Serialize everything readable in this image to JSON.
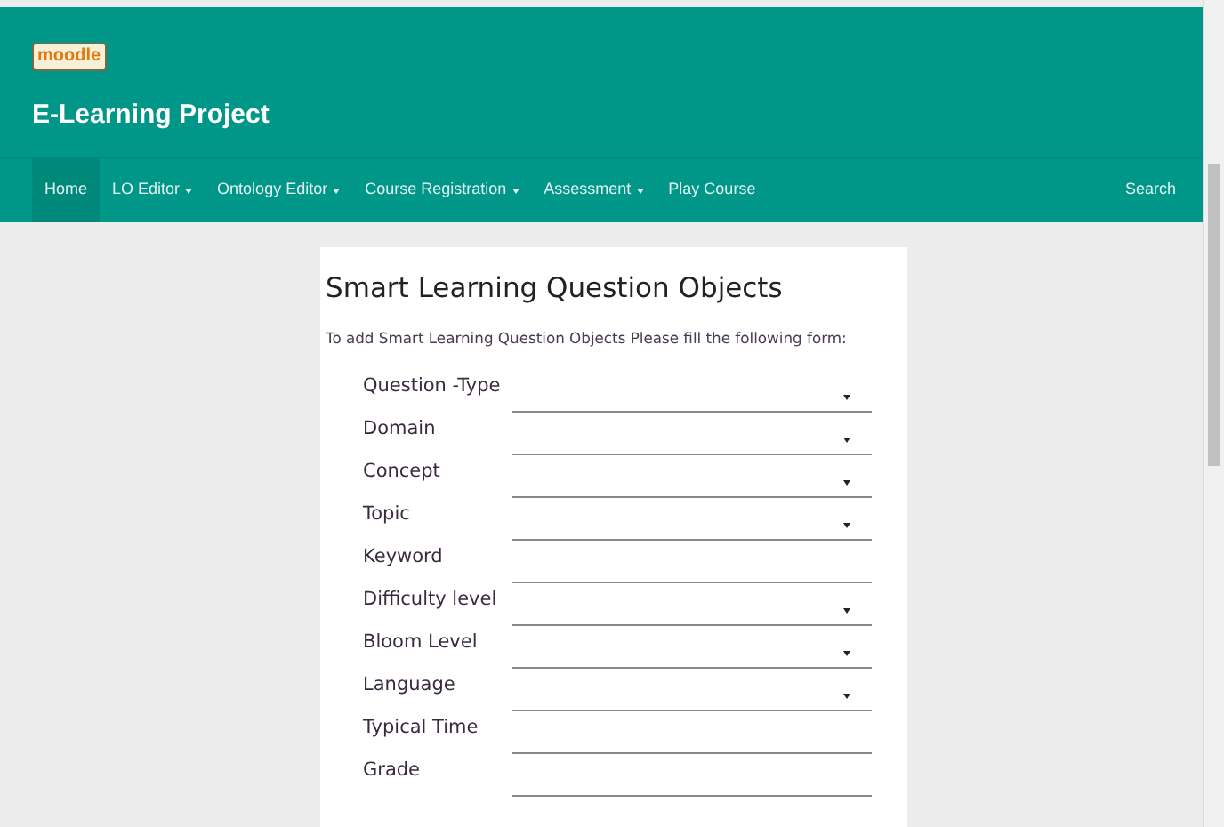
{
  "header": {
    "logo": "moodle",
    "title": "E-Learning Project"
  },
  "nav": {
    "items": [
      {
        "label": "Home",
        "selected": true,
        "dropdown": false
      },
      {
        "label": "LO Editor",
        "selected": false,
        "dropdown": true
      },
      {
        "label": "Ontology Editor",
        "selected": false,
        "dropdown": true
      },
      {
        "label": "Course Registration",
        "selected": false,
        "dropdown": true
      },
      {
        "label": "Assessment",
        "selected": false,
        "dropdown": true
      },
      {
        "label": "Play Course",
        "selected": false,
        "dropdown": false
      }
    ],
    "search": "Search"
  },
  "form": {
    "title": "Smart Learning Question Objects",
    "intro": "To add Smart Learning Question Objects Please fill the following form:",
    "fields": [
      {
        "label": "Question -Type",
        "kind": "select"
      },
      {
        "label": "Domain",
        "kind": "select"
      },
      {
        "label": "Concept",
        "kind": "select"
      },
      {
        "label": "Topic",
        "kind": "select"
      },
      {
        "label": "Keyword",
        "kind": "text"
      },
      {
        "label": "Difficulty level",
        "kind": "select"
      },
      {
        "label": "Bloom Level",
        "kind": "select"
      },
      {
        "label": "Language",
        "kind": "select"
      },
      {
        "label": "Typical Time",
        "kind": "text"
      },
      {
        "label": "Grade",
        "kind": "text"
      }
    ]
  }
}
